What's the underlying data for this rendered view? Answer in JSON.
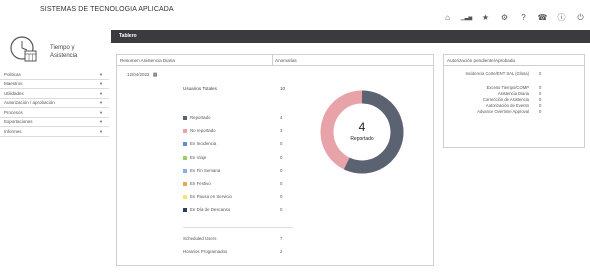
{
  "header": {
    "app_title": "SISTEMAS DE TECNOLOGIA APLICADA",
    "icons": [
      "home-icon",
      "chart-icon",
      "star-icon",
      "gear-icon",
      "help-icon",
      "phone-icon",
      "info-icon",
      "power-icon"
    ],
    "icon_glyphs": [
      "⌂",
      "▁▃▅",
      "★",
      "⚙",
      "?",
      "☎",
      "ⓘ",
      "⏻"
    ]
  },
  "sidebar": {
    "logo_text_1": "Tiempo y",
    "logo_text_2": "Asistencia",
    "items": [
      {
        "label": "Politicas"
      },
      {
        "label": "Maestros"
      },
      {
        "label": "Utilidades"
      },
      {
        "label": "Autorización / aprobación"
      },
      {
        "label": "Procesos"
      },
      {
        "label": "Exportaciones"
      },
      {
        "label": "Informes"
      }
    ],
    "caret": "▼"
  },
  "toolbar": {
    "title": "Tablero"
  },
  "main": {
    "tab_summary": "Resumen Asistencia Diaria",
    "tab_anomalies": "Anomalías",
    "date": "12/04/2022",
    "calendar_glyph": "▦",
    "total_users_label": "Usuarios Totales",
    "total_users_value": "10",
    "statuses": [
      {
        "label": "Reportado",
        "value": "4",
        "color": "#5b6373"
      },
      {
        "label": "No reportado",
        "value": "3",
        "color": "#e8a3a9"
      },
      {
        "label": "En Incidencia",
        "value": "0",
        "color": "#5b8fd6"
      },
      {
        "label": "En Viaje",
        "value": "0",
        "color": "#9ccf6a"
      },
      {
        "label": "En Fin Semana",
        "value": "0",
        "color": "#7fb3e6"
      },
      {
        "label": "En Festivo",
        "value": "0",
        "color": "#f0a64f"
      },
      {
        "label": "En Pausa en Servicio",
        "value": "0",
        "color": "#f2e37a"
      },
      {
        "label": "En Día de Descanso",
        "value": "0",
        "color": "#2f3c5c"
      }
    ],
    "scheduled_label": "Scheduled Users",
    "scheduled_value": "7",
    "programmed_label": "Horarios Programados",
    "programmed_value": "2",
    "donut": {
      "center_value": "4",
      "center_label": "Reportado",
      "reported_fraction": 0.571
    }
  },
  "right_panel": {
    "title": "Autorización pendiente/Aprobada",
    "rows": [
      {
        "label": "Incidencia Corte/ENT SAL (Glosa)",
        "value": "0"
      },
      {
        "label": "Exceso Tiempo/COMP",
        "value": "0"
      },
      {
        "label": "Asistencia Diaria",
        "value": "0"
      },
      {
        "label": "Corrección de Asistencia",
        "value": "0"
      },
      {
        "label": "Autorización de Evento",
        "value": "0"
      },
      {
        "label": "Advance Overtime Approval",
        "value": "0"
      }
    ]
  }
}
